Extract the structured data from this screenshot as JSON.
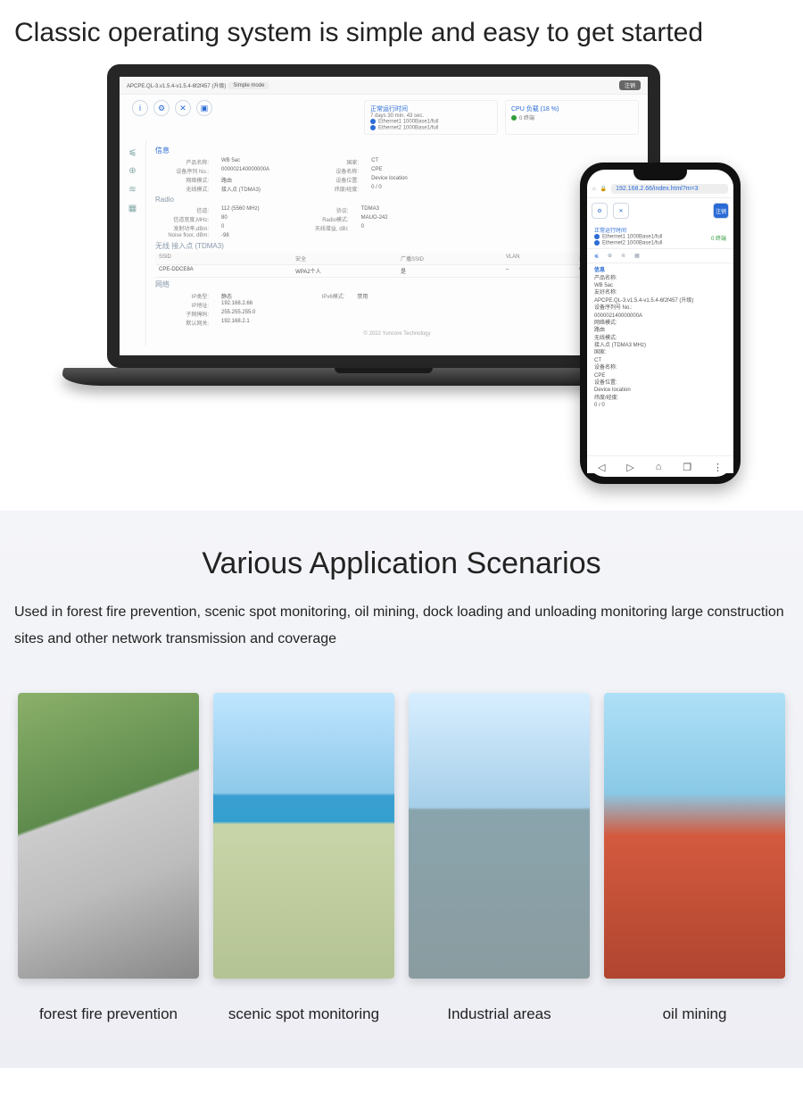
{
  "headline": "Classic operating system is simple and easy to get started",
  "laptop": {
    "topbar": {
      "firmware": "APCPE.QL-3.v1.5.4-v1.5.4-6f2f457 (升级)",
      "mode": "Simple mode",
      "button": "注销"
    },
    "icons": [
      "info-icon",
      "gear-icon",
      "tools-icon",
      "camera-icon"
    ],
    "stat1": {
      "title": "正常运行时间",
      "uptime": "7 days 30 min. 43 sec.",
      "eth1": "1000Base1/full",
      "eth2": "1000Base1/full",
      "ethlabel1": "Ethernet1",
      "ethlabel2": "Ethernet2"
    },
    "stat2": {
      "title": "CPU 负载 (18 %)",
      "clients": "0 终端"
    },
    "side": [
      "chart-icon",
      "globe-icon",
      "wifi-icon",
      "grid-icon"
    ],
    "info_title": "信息",
    "info_left": [
      {
        "l": "产品名称:",
        "v": "WB 5ac"
      },
      {
        "l": "设备序列 No.:",
        "v": "000002140000000A"
      },
      {
        "l": "网络模式:",
        "v": "路由"
      },
      {
        "l": "无线模式:",
        "v": "接入点 (TDMA3)"
      }
    ],
    "info_right": [
      {
        "l": "国家:",
        "v": "CT"
      },
      {
        "l": "设备名称:",
        "v": "CPE"
      },
      {
        "l": "设备位置:",
        "v": "Device location"
      },
      {
        "l": "纬度/经度:",
        "v": "0 / 0"
      }
    ],
    "radio_title": "Radio",
    "radio_left": [
      {
        "l": "信道:",
        "v": "112 (5560 MHz)"
      },
      {
        "l": "信道宽度,MHz:",
        "v": "80"
      },
      {
        "l": "发射功率,dBm:",
        "v": "0"
      },
      {
        "l": "Noise floor, dBm:",
        "v": "-98"
      }
    ],
    "radio_right": [
      {
        "l": "协议:",
        "v": "TDMA3"
      },
      {
        "l": "Radio模式:",
        "v": "MAUO-242"
      },
      {
        "l": "天线增益, dBi:",
        "v": "0"
      }
    ],
    "wireless_title": "无线  接入点 (TDMA3)",
    "table": {
      "headers": [
        "SSID",
        "安全",
        "广播SSID",
        "VLAN",
        "终端"
      ],
      "row": [
        "CPE-DDCE8A",
        "WPA2个人",
        "是",
        "–",
        "0"
      ]
    },
    "network_title": "网络",
    "net_left": [
      {
        "l": "IP类型:",
        "v": "静态"
      },
      {
        "l": "IP地址:",
        "v": "192.168.2.66"
      },
      {
        "l": "子网掩码:",
        "v": "255.255.255.0"
      },
      {
        "l": "默认网关:",
        "v": "192.168.2.1"
      }
    ],
    "net_right": [
      {
        "l": "IPv6模式:",
        "v": "禁用"
      }
    ],
    "footer": "© 2022 Yuncore Technology"
  },
  "phone": {
    "url": "192.168.2.66/index.html?m=3",
    "buttons": [
      "gear-icon",
      "tools-icon"
    ],
    "logout": "注销",
    "stat_uptime": "正常运行时间",
    "eth1": "1000Base1/full",
    "eth2": "1000Base1/full",
    "ethlabel1": "Ethernet1",
    "ethlabel2": "Ethernet2",
    "clients": "0 终端",
    "tabs": [
      "chart-icon",
      "globe-icon",
      "wifi-icon",
      "grid-icon"
    ],
    "info_title": "信息",
    "lines": [
      {
        "k": "产品名称:",
        "v": "WB 5ac"
      },
      {
        "k": "友好名称:",
        "v": "APCPE.QL-3.v1.5.4-v1.5.4-6f2f457 (升级)"
      },
      {
        "k": "设备序列号 No.:",
        "v": "000002140000000A"
      },
      {
        "k": "网络模式:",
        "v": "路由"
      },
      {
        "k": "无线模式:",
        "v": "接入点 (TDMA3 MHz)"
      },
      {
        "k": "国家:",
        "v": "CT"
      },
      {
        "k": "设备名称:",
        "v": "CPE"
      },
      {
        "k": "设备位置:",
        "v": "Device location"
      },
      {
        "k": "纬度/经度:",
        "v": "0 / 0"
      }
    ]
  },
  "scenarios": {
    "heading": "Various Application Scenarios",
    "description": "Used in forest fire prevention, scenic spot monitoring, oil mining, dock loading and unloading monitoring large construction sites and other network transmission and coverage",
    "cards": [
      {
        "caption": "forest fire prevention"
      },
      {
        "caption": "scenic spot monitoring"
      },
      {
        "caption": "Industrial areas"
      },
      {
        "caption": "oil mining"
      }
    ]
  }
}
